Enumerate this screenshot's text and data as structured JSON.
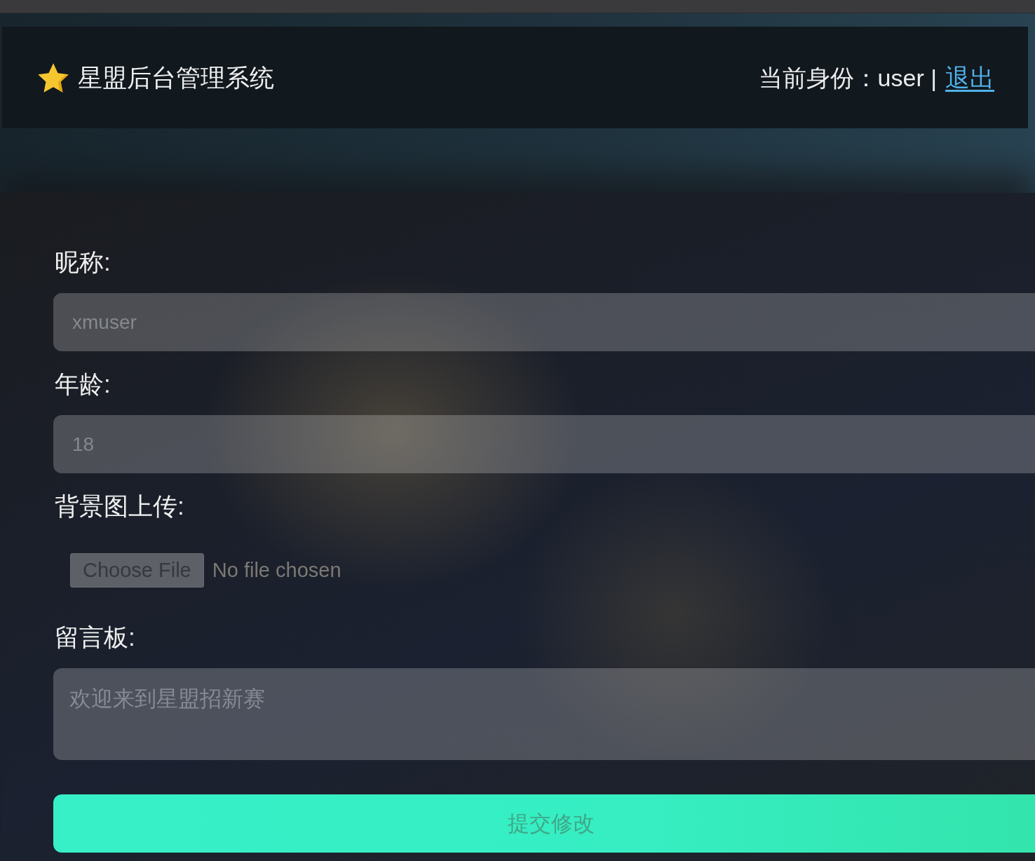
{
  "header": {
    "title": "星盟后台管理系统",
    "identity": "当前身份：user |",
    "logout": "退出"
  },
  "form": {
    "fields": [
      {
        "kind": "text",
        "label": "昵称:",
        "placeholder": "xmuser"
      },
      {
        "kind": "text",
        "label": "年龄:",
        "placeholder": "18"
      },
      {
        "kind": "file",
        "label": "背景图上传:",
        "button": "Choose File",
        "status": "No file chosen"
      },
      {
        "kind": "textarea",
        "label": "留言板:",
        "placeholder": "欢迎来到星盟招新赛"
      }
    ],
    "submit": "提交修改"
  }
}
